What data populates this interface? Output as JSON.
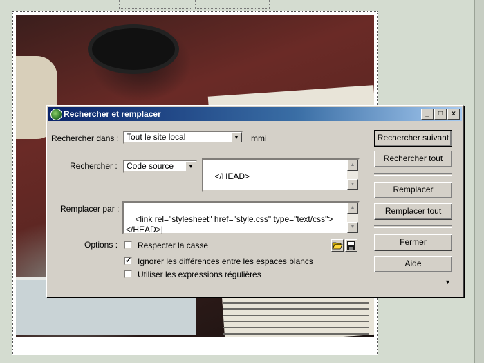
{
  "dialog": {
    "title": "Rechercher et remplacer",
    "window_buttons": {
      "minimize": "_",
      "maximize": "□",
      "close": "x"
    },
    "search_in": {
      "label": "Rechercher dans :",
      "value": "Tout le site local",
      "suffix": "mmi"
    },
    "search": {
      "label": "Rechercher :",
      "type_value": "Code source",
      "text": "</HEAD>"
    },
    "replace": {
      "label": "Remplacer par :",
      "text": "<link rel=\"stylesheet\" href=\"style.css\" type=\"text/css\">\n</HEAD>|"
    },
    "options": {
      "label": "Options :",
      "items": [
        {
          "label": "Respecter la casse",
          "checked": false,
          "mark": ""
        },
        {
          "label": "Ignorer les différences entre les espaces blancs",
          "checked": true,
          "mark": "✓"
        },
        {
          "label": "Utiliser les expressions régulières",
          "checked": false,
          "mark": ""
        }
      ]
    },
    "buttons": {
      "find_next": "Rechercher suivant",
      "find_all": "Rechercher tout",
      "replace": "Remplacer",
      "replace_all": "Remplacer tout",
      "close": "Fermer",
      "help": "Aide"
    },
    "scroll_arrows": {
      "up": "▲",
      "down": "▼"
    },
    "dropdown_arrow": "▼",
    "more_arrow": "▼"
  },
  "icons": [
    "open-folder-icon",
    "save-icon",
    "app-icon"
  ]
}
